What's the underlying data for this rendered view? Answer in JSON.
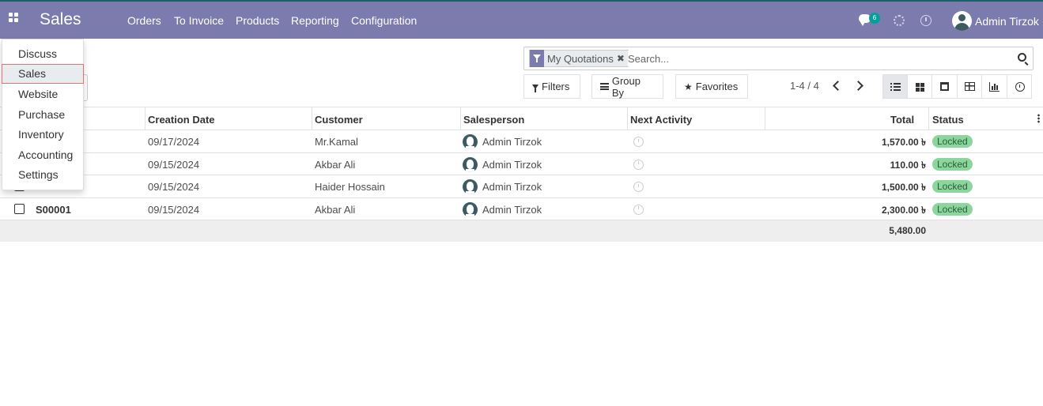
{
  "navbar": {
    "brand": "Sales",
    "menu": [
      "Orders",
      "To Invoice",
      "Products",
      "Reporting",
      "Configuration"
    ],
    "chat_count": "6",
    "user_name": "Admin Tirzok"
  },
  "search": {
    "facet_label": "My Quotations",
    "facet_remove": "✖",
    "placeholder": "Search..."
  },
  "control_panel": {
    "filters_label": "Filters",
    "group_by_label": "Group By",
    "favorites_label": "Favorites",
    "pager_value": "1-4 / 4"
  },
  "table": {
    "columns": {
      "creation_date": "Creation Date",
      "customer": "Customer",
      "salesperson": "Salesperson",
      "next_activity": "Next Activity",
      "total": "Total",
      "status": "Status"
    },
    "rows": [
      {
        "number": "",
        "date": "09/17/2024",
        "customer": "Mr.Kamal",
        "salesperson": "Admin Tirzok",
        "total": "1,570.00 ৳",
        "status": "Locked"
      },
      {
        "number": "",
        "date": "09/15/2024",
        "customer": "Akbar Ali",
        "salesperson": "Admin Tirzok",
        "total": "110.00 ৳",
        "status": "Locked"
      },
      {
        "number": "",
        "date": "09/15/2024",
        "customer": "Haider Hossain",
        "salesperson": "Admin Tirzok",
        "total": "1,500.00 ৳",
        "status": "Locked"
      },
      {
        "number": "S00001",
        "date": "09/15/2024",
        "customer": "Akbar Ali",
        "salesperson": "Admin Tirzok",
        "total": "2,300.00 ৳",
        "status": "Locked"
      }
    ],
    "footer_total": "5,480.00"
  },
  "app_menu": {
    "items": [
      "Discuss",
      "Sales",
      "Website",
      "Purchase",
      "Inventory",
      "Accounting",
      "Settings"
    ],
    "active": "Sales"
  },
  "colors": {
    "navbar": "#7c7bad",
    "status_locked": "#8bd69d",
    "accent": "#00a09d"
  }
}
